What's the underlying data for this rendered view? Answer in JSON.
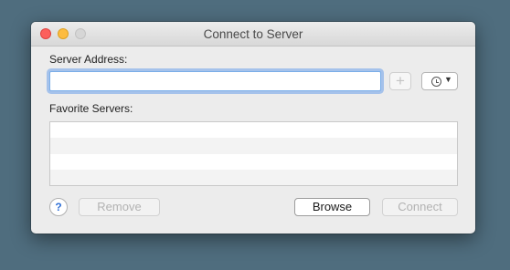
{
  "window": {
    "title": "Connect to Server"
  },
  "server_address": {
    "label": "Server Address:",
    "value": "",
    "placeholder": ""
  },
  "buttons": {
    "add_symbol": "+",
    "remove": "Remove",
    "browse": "Browse",
    "connect": "Connect",
    "help_symbol": "?"
  },
  "favorites": {
    "label": "Favorite Servers:",
    "items": []
  },
  "recent_servers": {
    "icon": "clock-icon"
  }
}
